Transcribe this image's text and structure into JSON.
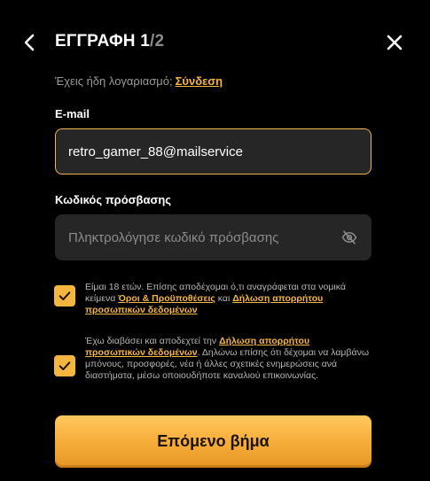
{
  "header": {
    "back_icon": "chevron-left-icon",
    "title": "ΕΓΓΡΑΦΗ",
    "step_current": "1",
    "step_total": "/2",
    "close_icon": "close-icon"
  },
  "login": {
    "prompt": "Έχεις ήδη λογαριασμό;",
    "link": "Σύνδεση"
  },
  "email": {
    "label": "E-mail",
    "value": "retro_gamer_88@mailservice"
  },
  "password": {
    "label": "Κωδικός πρόσβασης",
    "placeholder": "Πληκτρολόγησε κωδικό πρόσβασης",
    "visibility_icon": "eye-off-icon"
  },
  "consents": [
    {
      "checked": true,
      "text_before": "Είμαι 18 ετών. Επίσης αποδέχομαι ό,τι αναγράφεται στα νομικά κείμενα ",
      "link1": "Όροι & Προϋποθέσεις",
      "text_middle": " και ",
      "link2": "Δήλωση απορρήτου προσωπικών δεδομένων"
    },
    {
      "checked": true,
      "text_before": "Έχω διαβάσει και αποδεχτεί την ",
      "link1": "Δήλωση απορρήτου προσωπικών δεδομένων",
      "text_after": ". Δηλώνω επίσης ότι δέχομαι να λαμβάνω μπόνους, προσφορές, νέα ή άλλες σχετικές ενημερώσεις ανά διαστήματα, μέσω οποιουδήποτε καναλιού επικοινωνίας."
    }
  ],
  "cta": {
    "label": "Επόμενο βήμα"
  },
  "colors": {
    "accent": "#f5b640",
    "background": "#000000",
    "input_bg": "#262626"
  }
}
